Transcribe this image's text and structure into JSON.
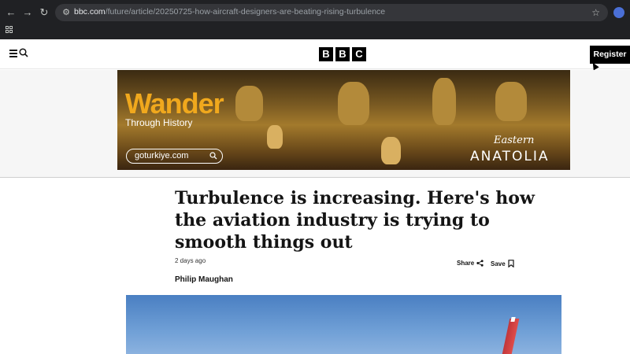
{
  "browser": {
    "url_host": "bbc.com",
    "url_path": "/future/article/20250725-how-aircraft-designers-are-beating-rising-turbulence",
    "back_icon": "arrow-left-icon",
    "forward_icon": "arrow-right-icon",
    "reload_icon": "reload-icon",
    "bookmark_icon": "star-icon",
    "apps_icon": "grid-icon"
  },
  "header": {
    "logo_letters": [
      "B",
      "B",
      "C"
    ],
    "register_label": "Register",
    "menu_icon": "menu-icon",
    "search_icon": "search-icon"
  },
  "ad": {
    "title": "Wander",
    "subtitle": "Through History",
    "url": "goturkiye.com",
    "brand_line1": "Eastern",
    "brand_line2": "ANATOLIA",
    "colors": {
      "title": "#f0a81d"
    }
  },
  "article": {
    "headline": "Turbulence is increasing. Here's how the aviation industry is trying to smooth things out",
    "timestamp": "2 days ago",
    "share_label": "Share",
    "save_label": "Save",
    "author": "Philip Maughan"
  },
  "colors": {
    "chrome_bg": "#202124",
    "omnibox_bg": "#35363a",
    "accent": "#000000"
  }
}
